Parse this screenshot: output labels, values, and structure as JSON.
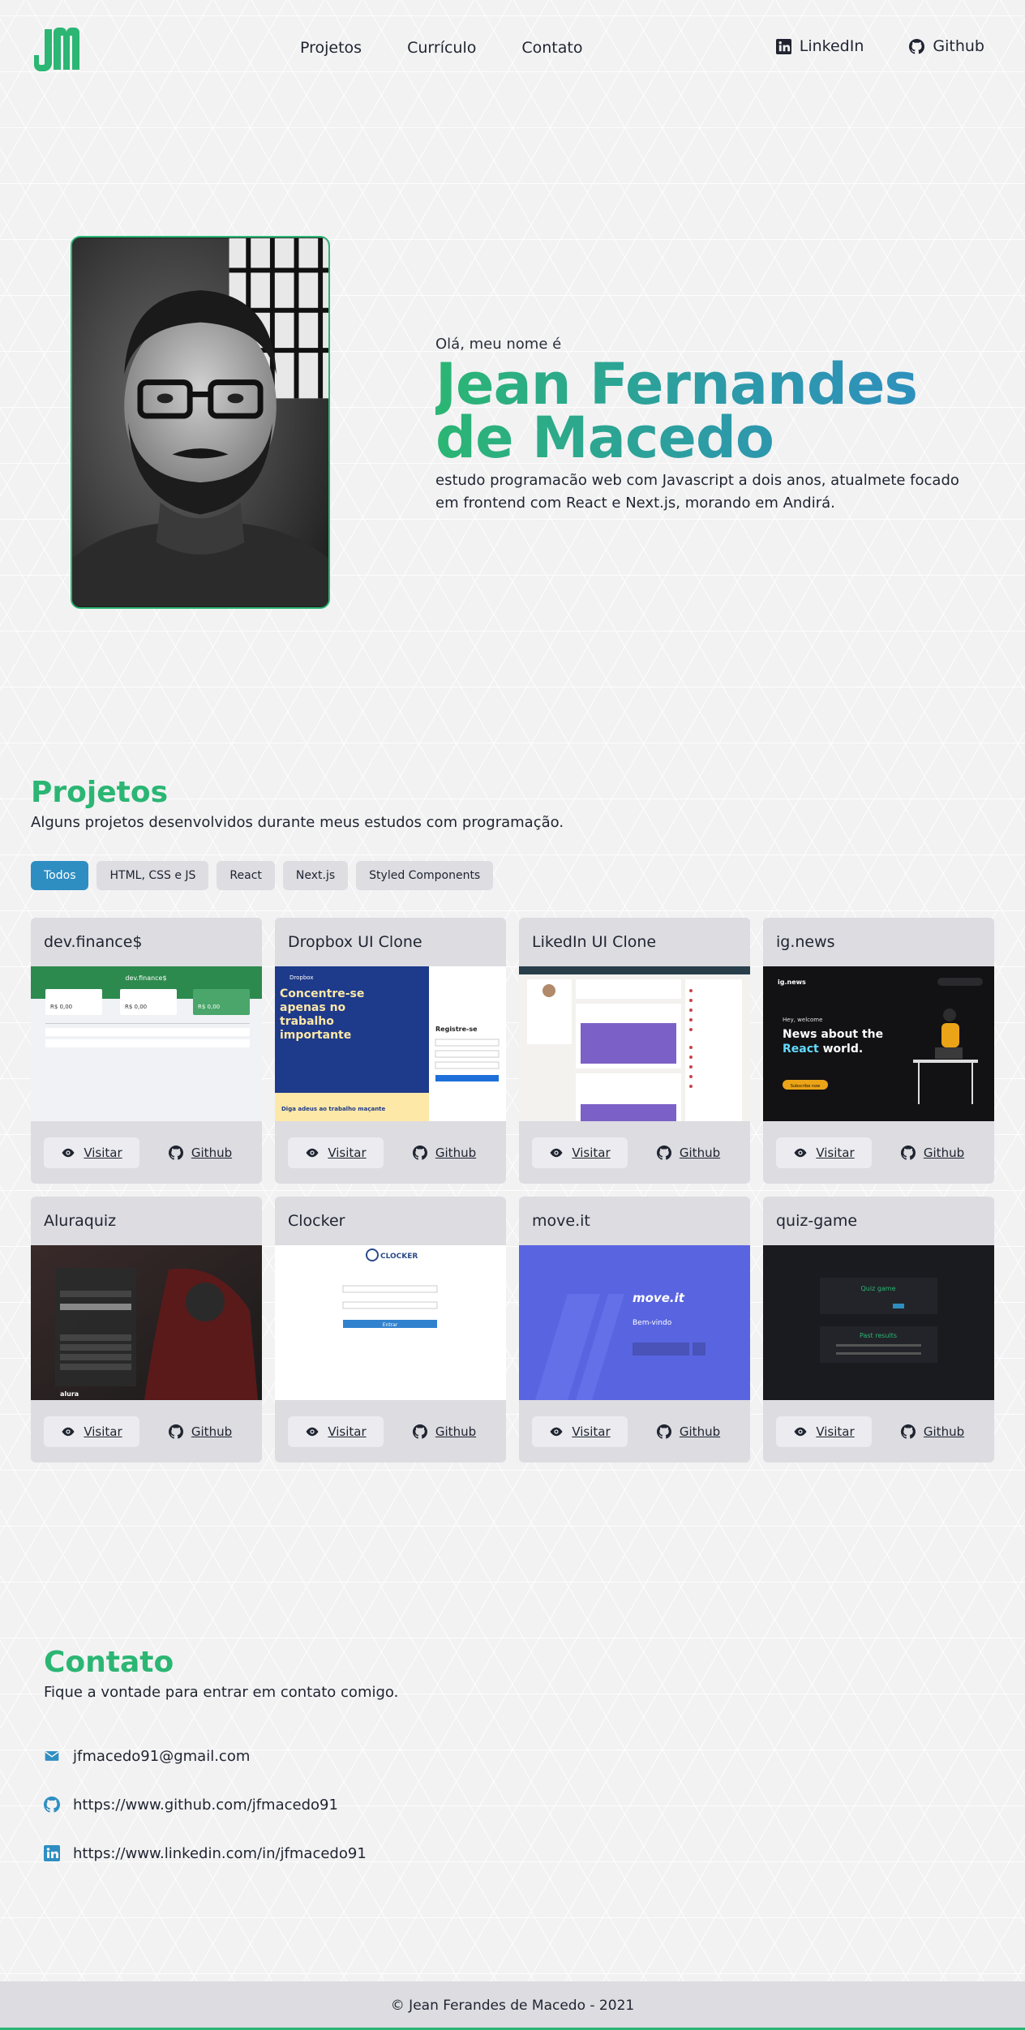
{
  "header": {
    "logo_icon": "jm-monogram-logo",
    "nav": [
      {
        "label": "Projetos"
      },
      {
        "label": "Currículo"
      },
      {
        "label": "Contato"
      }
    ],
    "social": [
      {
        "label": "LinkedIn",
        "icon": "linkedin-icon"
      },
      {
        "label": "Github",
        "icon": "github-icon"
      }
    ]
  },
  "hero": {
    "greeting": "Olá, meu nome é",
    "name_line1": "Jean Fernandes",
    "name_line2": "de Macedo",
    "description": "estudo programacão web com Javascript a dois anos, atualmete focado em frontend com React e Next.js, morando em Andirá."
  },
  "projects": {
    "title": "Projetos",
    "subtitle": "Alguns projetos desenvolvidos durante meus estudos com programação.",
    "filters": [
      "Todos",
      "HTML, CSS e JS",
      "React",
      "Next.js",
      "Styled Components"
    ],
    "active_filter": "Todos",
    "visit_label": "Visitar",
    "github_label": "Github",
    "items": [
      {
        "name": "dev.finance$",
        "thumb": "finance",
        "header_text": "dev.finance$",
        "value_text": "R$ 0,00"
      },
      {
        "name": "Dropbox UI Clone",
        "thumb": "dropbox",
        "brand": "Dropbox",
        "hero_text": "Concentre-se apenas no trabalho importante",
        "register_text": "Registre-se",
        "footer_text": "Diga adeus ao trabalho maçante"
      },
      {
        "name": "LikedIn UI Clone",
        "thumb": "linkedin"
      },
      {
        "name": "ig.news",
        "thumb": "ignews",
        "brand": "ig.news",
        "hey_text": "Hey, welcome",
        "headline_line1": "News about the",
        "headline_accent": "React",
        "headline_rest": "world.",
        "cta_text": "Subscribe now"
      },
      {
        "name": "Aluraquiz",
        "thumb": "aluraquiz",
        "brand": "alura"
      },
      {
        "name": "Clocker",
        "thumb": "clocker",
        "brand": "CLOCKER",
        "button_text": "Entrar"
      },
      {
        "name": "move.it",
        "thumb": "moveit",
        "brand": "move.it",
        "welcome_text": "Bem-vindo"
      },
      {
        "name": "quiz-game",
        "thumb": "quizgame",
        "title_text": "Quiz game",
        "results_text": "Past results"
      }
    ]
  },
  "contact": {
    "title": "Contato",
    "subtitle": "Fique a vontade para entrar em contato comigo.",
    "items": [
      {
        "icon": "email-icon",
        "text": "jfmacedo91@gmail.com"
      },
      {
        "icon": "github-icon",
        "text": "https://www.github.com/jfmacedo91"
      },
      {
        "icon": "linkedin-icon",
        "text": "https://www.linkedin.com/in/jfmacedo91"
      }
    ]
  },
  "footer": {
    "text": "© Jean Ferandes de Macedo - 2021"
  },
  "colors": {
    "accent_green": "#2bb673",
    "accent_blue": "#2e8ec2",
    "card_bg": "#dcdce1"
  }
}
